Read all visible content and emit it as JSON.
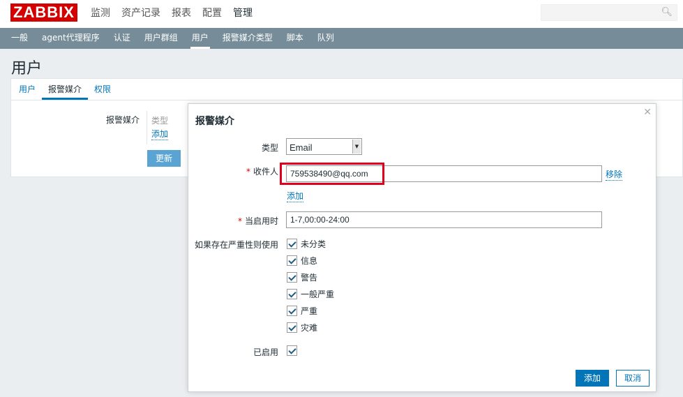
{
  "header": {
    "logo": "ZABBIX",
    "menu": [
      "监测",
      "资产记录",
      "报表",
      "配置",
      "管理"
    ],
    "active_menu": "管理",
    "search_placeholder": ""
  },
  "subnav": {
    "items": [
      "一般",
      "agent代理程序",
      "认证",
      "用户群组",
      "用户",
      "报警媒介类型",
      "脚本",
      "队列"
    ],
    "active": "用户"
  },
  "page": {
    "title": "用户",
    "tabs": [
      "用户",
      "报警媒介",
      "权限"
    ],
    "active_tab": "报警媒介",
    "media_label": "报警媒介",
    "media_table_header": "类型",
    "media_add_link": "添加",
    "update_button": "更新"
  },
  "modal": {
    "title": "报警媒介",
    "type_label": "类型",
    "type_value": "Email",
    "recipient_label": "收件人",
    "recipient_value": "759538490@qq.com",
    "remove_link": "移除",
    "add_recipient_link": "添加",
    "when_active_label": "当启用时",
    "when_active_value": "1-7,00:00-24:00",
    "severity_label": "如果存在严重性则使用",
    "severities": [
      "未分类",
      "信息",
      "警告",
      "一般严重",
      "严重",
      "灾难"
    ],
    "enabled_label": "已启用",
    "add_button": "添加",
    "cancel_button": "取消"
  },
  "colors": {
    "logo_red": "#d40000",
    "subnav_bg": "#768d99",
    "primary_blue": "#0275b8",
    "highlight_red": "#e0001e"
  }
}
